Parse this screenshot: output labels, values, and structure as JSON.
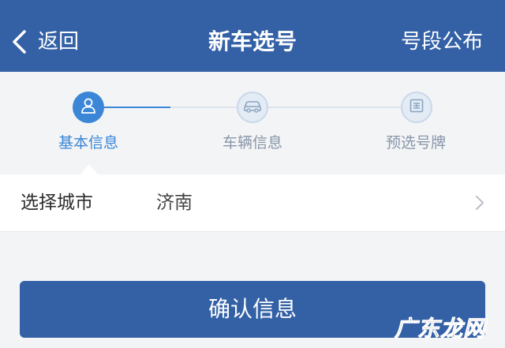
{
  "header": {
    "back_label": "返回",
    "title": "新车选号",
    "action_label": "号段公布"
  },
  "steps": [
    {
      "label": "基本信息",
      "icon": "user-icon",
      "state": "active"
    },
    {
      "label": "车辆信息",
      "icon": "car-icon",
      "state": "inactive"
    },
    {
      "label": "预选号牌",
      "icon": "license-plate-icon",
      "state": "inactive"
    }
  ],
  "form": {
    "city_label": "选择城市",
    "city_value": "济南"
  },
  "confirm_label": "确认信息",
  "watermark": "广东龙网",
  "colors": {
    "brand_blue": "#3461a6",
    "active_blue": "#3b86d6",
    "inactive_gray": "#8896a8"
  }
}
